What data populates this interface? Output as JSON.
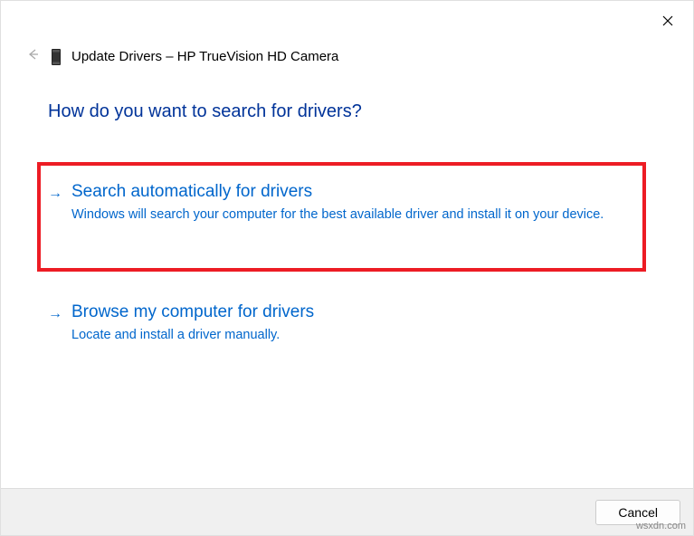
{
  "header": {
    "title": "Update Drivers – HP TrueVision HD Camera"
  },
  "question": "How do you want to search for drivers?",
  "options": [
    {
      "title": "Search automatically for drivers",
      "desc": "Windows will search your computer for the best available driver and install it on your device."
    },
    {
      "title": "Browse my computer for drivers",
      "desc": "Locate and install a driver manually."
    }
  ],
  "footer": {
    "cancel": "Cancel"
  },
  "watermark": "wsxdn.com"
}
